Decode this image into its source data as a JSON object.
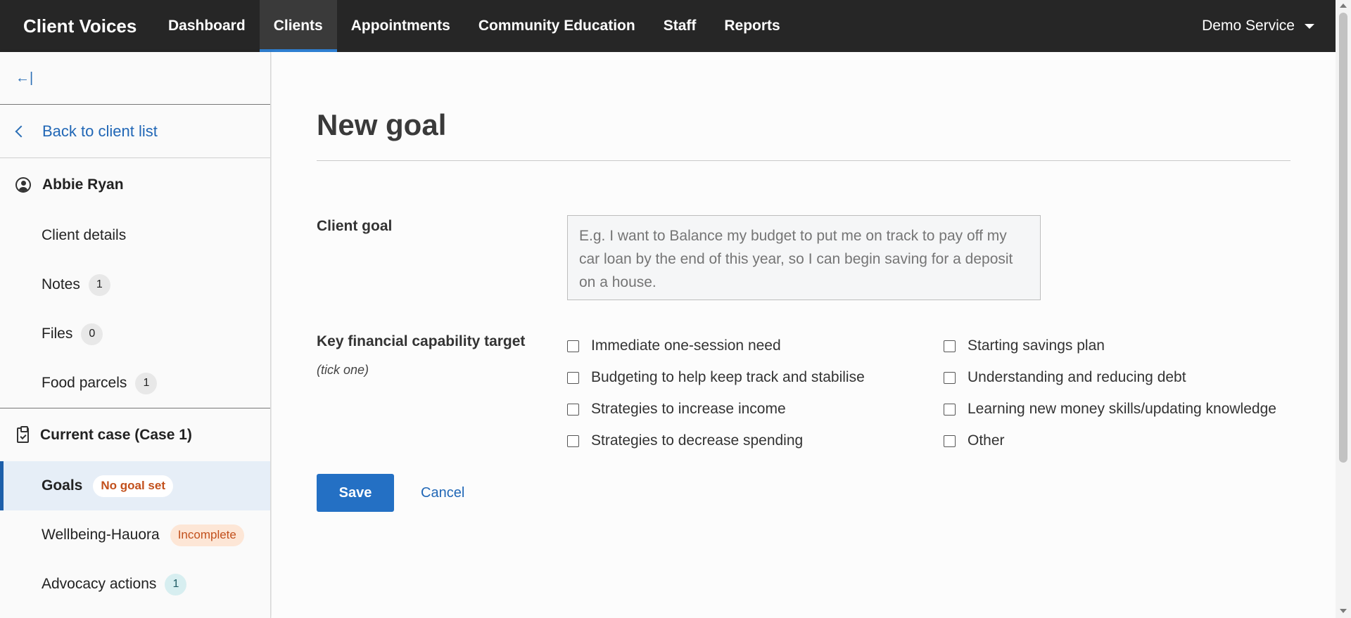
{
  "nav": {
    "brand": "Client Voices",
    "items": [
      {
        "label": "Dashboard"
      },
      {
        "label": "Clients"
      },
      {
        "label": "Appointments"
      },
      {
        "label": "Community Education"
      },
      {
        "label": "Staff"
      },
      {
        "label": "Reports"
      }
    ],
    "active": "Clients",
    "service": "Demo Service"
  },
  "sidebar": {
    "collapse_icon": "←|",
    "back_label": "Back to client list",
    "client_name": "Abbie Ryan",
    "client_items": [
      {
        "label": "Client details"
      },
      {
        "label": "Notes",
        "count": "1"
      },
      {
        "label": "Files",
        "count": "0"
      },
      {
        "label": "Food parcels",
        "count": "1"
      }
    ],
    "case_title": "Current case (Case 1)",
    "case_items": [
      {
        "label": "Goals",
        "badge": "No goal set",
        "active": true
      },
      {
        "label": "Wellbeing-Hauora",
        "badge": "Incomplete"
      },
      {
        "label": "Advocacy actions",
        "count": "1"
      }
    ]
  },
  "main": {
    "title": "New goal",
    "client_goal_label": "Client goal",
    "client_goal_placeholder": "E.g. I want to Balance my budget to put me on track to pay off my car loan by the end of this year, so I can begin saving for a deposit on a house.",
    "target_label": "Key financial capability target",
    "target_hint": "(tick one)",
    "options_left": [
      "Immediate one-session need",
      "Budgeting to help keep track and stabilise",
      "Strategies to increase income",
      "Strategies to decrease spending"
    ],
    "options_right": [
      "Starting savings plan",
      "Understanding and reducing debt",
      "Learning new money skills/updating knowledge",
      "Other"
    ],
    "save_label": "Save",
    "cancel_label": "Cancel"
  },
  "colors": {
    "nav_bg": "#262626",
    "accent": "#2470c4",
    "link": "#2167b6",
    "warning": "#c2501c"
  }
}
